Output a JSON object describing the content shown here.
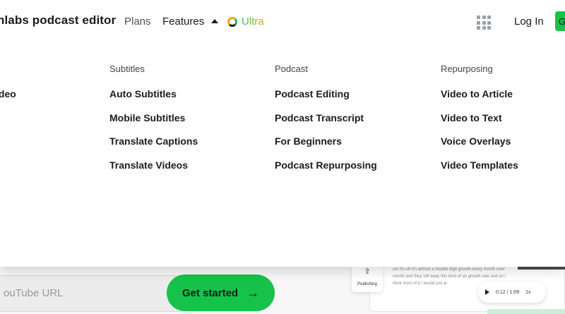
{
  "header": {
    "brand": "nlabs podcast editor",
    "nav": {
      "plans": "Plans",
      "features": "Features",
      "ultra": "Ultra"
    },
    "login": "Log In",
    "cta_partial": "G"
  },
  "menu": {
    "columns": [
      {
        "heading": "",
        "items": [
          "ideo"
        ]
      },
      {
        "heading": "Subtitles",
        "items": [
          "Auto Subtitles",
          "Mobile Subtitles",
          "Translate Captions",
          "Translate Videos"
        ]
      },
      {
        "heading": "Podcast",
        "items": [
          "Podcast Editing",
          "Podcast Transcript",
          "For Beginners",
          "Podcast Repurposing"
        ]
      },
      {
        "heading": "Repurposing",
        "items": [
          "Video to Article",
          "Video to Text",
          "Voice Overlays",
          "Video Templates"
        ]
      }
    ]
  },
  "hero": {
    "url_placeholder": "ouTube URL",
    "cta_label": "Get started",
    "publishing_label": "Publishing",
    "transcript_text": "um it's uh it's almost a double digit growth every month over month and they still keep this kind of un growth rate and un I think most of it I would just ar",
    "player_time": "0:12 / 1:09",
    "player_speed": "1x"
  }
}
